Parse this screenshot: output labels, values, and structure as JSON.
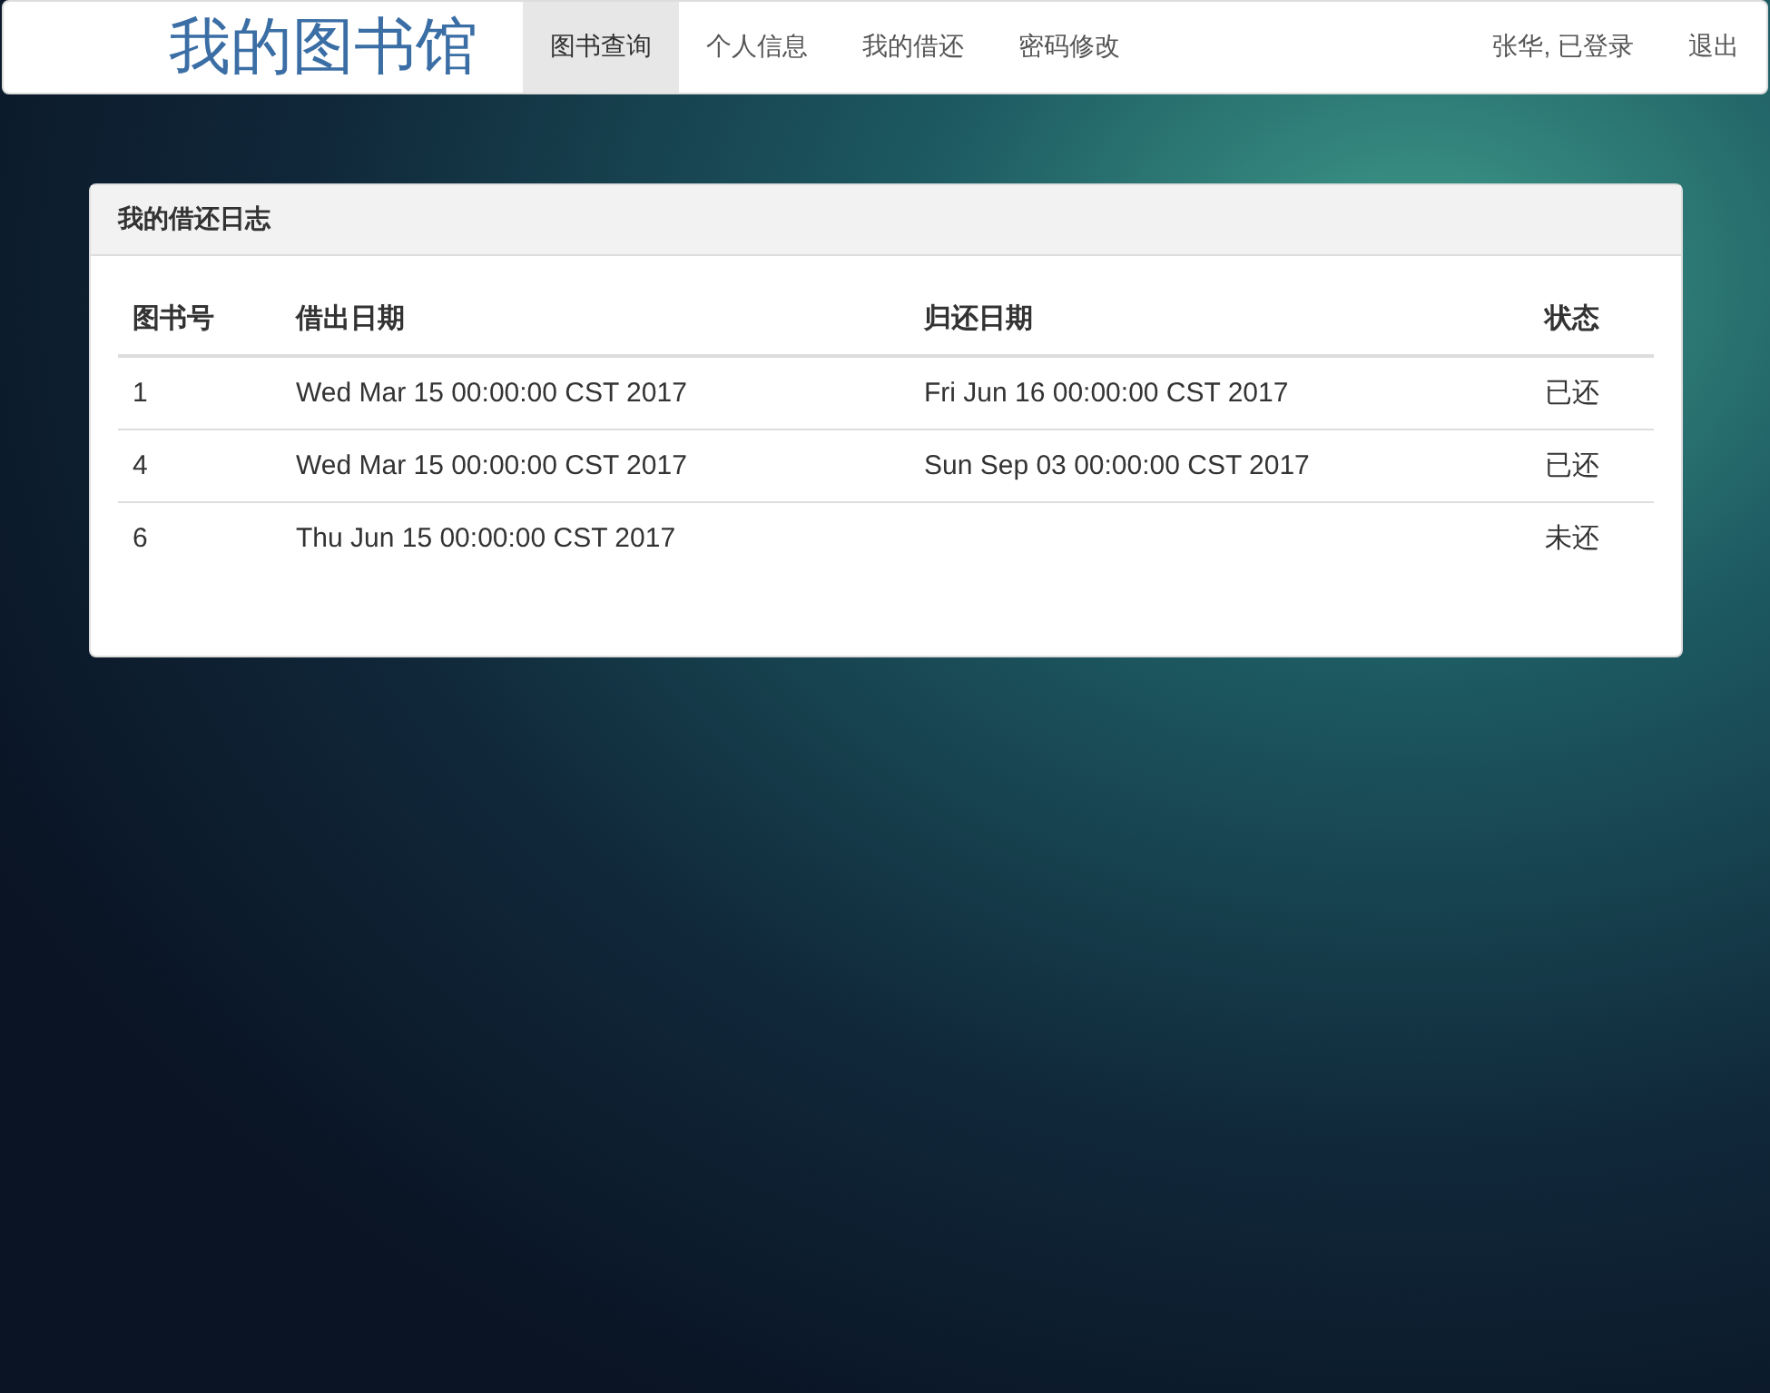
{
  "navbar": {
    "brand": "我的图书馆",
    "items": [
      {
        "label": "图书查询",
        "selected": true
      },
      {
        "label": "个人信息",
        "selected": false
      },
      {
        "label": "我的借还",
        "selected": false
      },
      {
        "label": "密码修改",
        "selected": false
      }
    ],
    "user": "张华, 已登录",
    "logout": "退出"
  },
  "panel": {
    "title": "我的借还日志",
    "columns": [
      "图书号",
      "借出日期",
      "归还日期",
      "状态"
    ],
    "rows": [
      {
        "book_id": "1",
        "borrow_date": "Wed Mar 15 00:00:00 CST 2017",
        "return_date": "Fri Jun 16 00:00:00 CST 2017",
        "status": "已还"
      },
      {
        "book_id": "4",
        "borrow_date": "Wed Mar 15 00:00:00 CST 2017",
        "return_date": "Sun Sep 03 00:00:00 CST 2017",
        "status": "已还"
      },
      {
        "book_id": "6",
        "borrow_date": "Thu Jun 15 00:00:00 CST 2017",
        "status": "未还"
      }
    ]
  }
}
